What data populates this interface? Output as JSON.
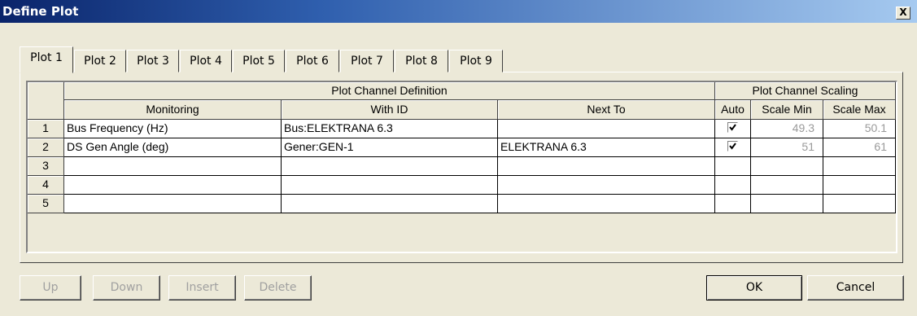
{
  "window": {
    "title": "Define Plot",
    "close_label": "X"
  },
  "tabs": [
    {
      "label": "Plot 1"
    },
    {
      "label": "Plot 2"
    },
    {
      "label": "Plot 3"
    },
    {
      "label": "Plot 4"
    },
    {
      "label": "Plot 5"
    },
    {
      "label": "Plot 6"
    },
    {
      "label": "Plot 7"
    },
    {
      "label": "Plot 8"
    },
    {
      "label": "Plot 9"
    }
  ],
  "active_tab": "Plot 1",
  "table": {
    "group_headers": {
      "definition": "Plot Channel Definition",
      "scaling": "Plot Channel Scaling"
    },
    "columns": {
      "monitoring": "Monitoring",
      "with_id": "With ID",
      "next_to": "Next To",
      "auto": "Auto",
      "scale_min": "Scale Min",
      "scale_max": "Scale Max"
    },
    "rows": [
      {
        "num": "1",
        "monitoring": "Bus Frequency (Hz)",
        "with_id": "Bus:ELEKTRANA 6.3",
        "next_to": "",
        "auto": true,
        "scale_min": "49.3",
        "scale_max": "50.1"
      },
      {
        "num": "2",
        "monitoring": "DS Gen Angle (deg)",
        "with_id": "Gener:GEN-1",
        "next_to": "ELEKTRANA 6.3",
        "auto": true,
        "scale_min": "51",
        "scale_max": "61"
      },
      {
        "num": "3",
        "monitoring": "",
        "with_id": "",
        "next_to": "",
        "auto": false,
        "scale_min": "",
        "scale_max": ""
      },
      {
        "num": "4",
        "monitoring": "",
        "with_id": "",
        "next_to": "",
        "auto": false,
        "scale_min": "",
        "scale_max": ""
      },
      {
        "num": "5",
        "monitoring": "",
        "with_id": "",
        "next_to": "",
        "auto": false,
        "scale_min": "",
        "scale_max": ""
      }
    ]
  },
  "buttons": {
    "up": "Up",
    "down": "Down",
    "insert": "Insert",
    "delete": "Delete",
    "ok": "OK",
    "cancel": "Cancel"
  }
}
